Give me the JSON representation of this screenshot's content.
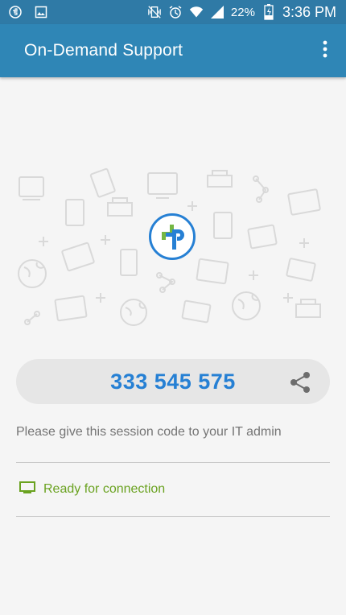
{
  "status_bar": {
    "battery_percent": "22%",
    "time": "3:36 PM",
    "icons": [
      "app-logo-icon",
      "gallery-icon",
      "vibrate-mute-icon",
      "alarm-icon",
      "wifi-icon",
      "signal-icon",
      "battery-charging-icon"
    ]
  },
  "app_bar": {
    "title": "On-Demand Support",
    "menu_icon": "more-vert-icon"
  },
  "session": {
    "code": "333 545 575",
    "share_icon": "share-icon",
    "instruction": "Please give this session code to your IT admin"
  },
  "connection": {
    "icon": "monitor-icon",
    "status_text": "Ready for connection",
    "status_color": "#6aa220"
  },
  "colors": {
    "status_bar": "#2f7aa6",
    "app_bar": "#2f86b6",
    "accent": "#2680d4",
    "logo_green": "#75b743"
  }
}
